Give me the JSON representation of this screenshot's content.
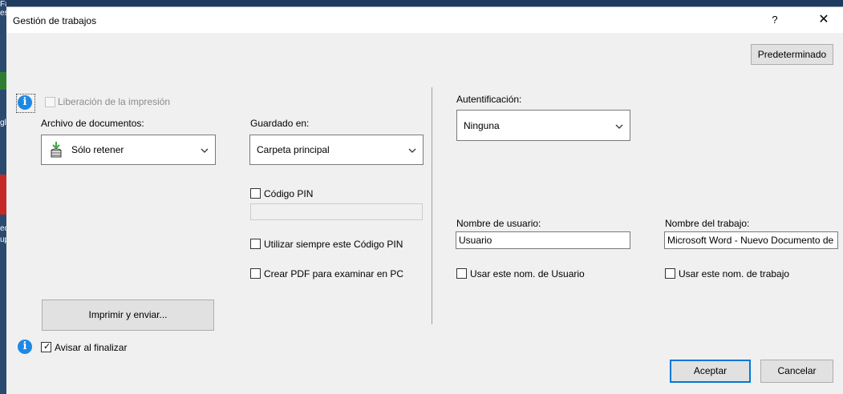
{
  "dialog": {
    "title": "Gestión de trabajos",
    "help_label": "?",
    "close_label": "✕"
  },
  "buttons": {
    "default_label": "Predeterminado",
    "print_send_label": "Imprimir y enviar...",
    "ok_label": "Aceptar",
    "cancel_label": "Cancelar"
  },
  "release": {
    "label": "Liberación de la impresión",
    "checked": false,
    "enabled": false
  },
  "document_filing": {
    "label": "Archivo de documentos:",
    "value": "Sólo retener"
  },
  "stored_in": {
    "label": "Guardado en:",
    "value": "Carpeta principal"
  },
  "pin": {
    "label": "Código PIN",
    "checked": false,
    "value": ""
  },
  "always_pin": {
    "label": "Utilizar siempre este Código PIN",
    "checked": false
  },
  "create_pdf": {
    "label": "Crear PDF para examinar en PC",
    "checked": false
  },
  "notify": {
    "label": "Avisar al finalizar",
    "checked": true
  },
  "authentication": {
    "label": "Autentificación:",
    "value": "Ninguna"
  },
  "username": {
    "label": "Nombre de usuario:",
    "value": "Usuario",
    "use_label": "Usar este nom. de Usuario",
    "use_checked": false
  },
  "jobname": {
    "label": "Nombre del trabajo:",
    "value": "Microsoft Word - Nuevo Documento de",
    "use_label": "Usar este nom. de trabajo",
    "use_checked": false
  },
  "icons": {
    "info": "info-icon",
    "document_filing": "stack-download-icon",
    "dropdown": "chevron-down-icon"
  },
  "desktop": {
    "left_texts": [
      "Fa",
      "es",
      "gl",
      "ec",
      "up"
    ]
  }
}
